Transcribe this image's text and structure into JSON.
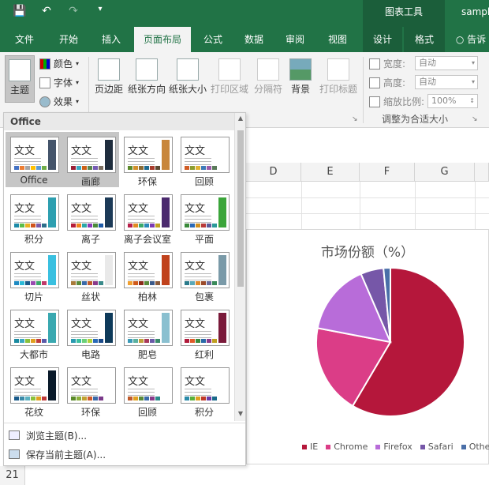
{
  "titlebar": {
    "context_group": "图表工具",
    "file_name": "sampl"
  },
  "tabs": [
    "文件",
    "开始",
    "插入",
    "页面布局",
    "公式",
    "数据",
    "审阅",
    "视图",
    "设计",
    "格式",
    "告诉"
  ],
  "ribbon": {
    "themes_label": "主题",
    "colors_label": "颜色",
    "fonts_label": "字体",
    "effects_label": "效果",
    "margins_label": "页边距",
    "orientation_label": "纸张方向",
    "size_label": "纸张大小",
    "print_area_label": "打印区域",
    "breaks_label": "分隔符",
    "background_label": "背景",
    "print_titles_label": "打印标题",
    "width_label": "宽度:",
    "width_value": "自动",
    "height_label": "高度:",
    "height_value": "自动",
    "scale_label": "缩放比例:",
    "scale_value": "100%",
    "fit_group_label": "调整为合适大小"
  },
  "columns": [
    "D",
    "E",
    "F",
    "G"
  ],
  "row_header": "21",
  "themes_panel": {
    "header": "Office",
    "sample_text": "文文",
    "themes": [
      {
        "name": "Office",
        "accent": "#44546a",
        "swatches": [
          "#4472c4",
          "#ed7d31",
          "#a5a5a5",
          "#ffc000",
          "#5b9bd5",
          "#70ad47"
        ]
      },
      {
        "name": "画廊",
        "accent": "#1f2d3d",
        "swatches": [
          "#9a1e35",
          "#38a8c2",
          "#cb5f15",
          "#57854d",
          "#765bb4",
          "#7c6f61"
        ]
      },
      {
        "name": "环保",
        "accent": "#c8863b",
        "swatches": [
          "#5b8a2a",
          "#d18f2b",
          "#8a6a33",
          "#1e6a8f",
          "#a83b2b",
          "#5b4a32"
        ]
      },
      {
        "name": "回顾",
        "accent": "#ffffff",
        "swatches": [
          "#d05c25",
          "#8a9c2e",
          "#e0b131",
          "#3d7ab8",
          "#9a5aa8",
          "#5a7a5a"
        ]
      },
      {
        "name": "积分",
        "accent": "#2e9fb0",
        "swatches": [
          "#1d8aa8",
          "#5bbd4a",
          "#e8b223",
          "#d0541c",
          "#7a5aa8",
          "#2a6e8a"
        ]
      },
      {
        "name": "离子",
        "accent": "#1c3a57",
        "swatches": [
          "#b51f3a",
          "#f1841b",
          "#2aa8a8",
          "#8a3ab8",
          "#4a8a3a",
          "#1d5aa8"
        ]
      },
      {
        "name": "离子会议室",
        "accent": "#4b2a6e",
        "swatches": [
          "#b81f4a",
          "#e08a22",
          "#3aa86a",
          "#2a8ab8",
          "#7a3ab0",
          "#c0a020"
        ]
      },
      {
        "name": "平面",
        "accent": "#3ba53a",
        "swatches": [
          "#3a8a3a",
          "#2a6ab8",
          "#d09020",
          "#b83a3a",
          "#5a5a9a",
          "#2a9a9a"
        ]
      },
      {
        "name": "切片",
        "accent": "#3ac0e0",
        "swatches": [
          "#1f8ac2",
          "#2abad8",
          "#1a5a8a",
          "#9a4ab0",
          "#3aa86a",
          "#c03a6a"
        ]
      },
      {
        "name": "丝状",
        "accent": "#e9e9e9",
        "swatches": [
          "#a87a3a",
          "#5a8a3a",
          "#3a6aa8",
          "#c05a2a",
          "#8a3a8a",
          "#3a8a8a"
        ]
      },
      {
        "name": "柏林",
        "accent": "#c0421c",
        "swatches": [
          "#f0a030",
          "#d05a1a",
          "#8a2a1a",
          "#5a8a3a",
          "#3a5a8a",
          "#8a5a3a"
        ]
      },
      {
        "name": "包裹",
        "accent": "#7a9aa8",
        "swatches": [
          "#2a7a8a",
          "#5aa8b8",
          "#e08a2a",
          "#9a4a2a",
          "#6a6a9a",
          "#3a8a5a"
        ]
      },
      {
        "name": "大都市",
        "accent": "#3aa8b0",
        "swatches": [
          "#1a8aa0",
          "#3aa8c0",
          "#8ac03a",
          "#e0a020",
          "#c03a3a",
          "#5a5aa8"
        ]
      },
      {
        "name": "电路",
        "accent": "#0e3a5a",
        "swatches": [
          "#2a9ab0",
          "#3ac0a0",
          "#6ad07a",
          "#b0d03a",
          "#2a6ab8",
          "#1a4a8a"
        ]
      },
      {
        "name": "肥皂",
        "accent": "#8ac0d0",
        "swatches": [
          "#3a9ab8",
          "#5ab0a0",
          "#c0a03a",
          "#a83a5a",
          "#6a5aa8",
          "#3a8a6a"
        ]
      },
      {
        "name": "红利",
        "accent": "#7a1a3a",
        "swatches": [
          "#b01a3a",
          "#e05a2a",
          "#3a8a3a",
          "#2a6aa8",
          "#8a3a8a",
          "#c0a020"
        ]
      },
      {
        "name": "花纹",
        "accent": "#0a1a2a",
        "swatches": [
          "#1a5a8a",
          "#3a8aa8",
          "#5ab0c0",
          "#8ac03a",
          "#e0a020",
          "#c03a3a"
        ]
      },
      {
        "name": "环保",
        "accent": "#ffffff",
        "swatches": [
          "#5a8a2a",
          "#8ab03a",
          "#c0a030",
          "#d05a2a",
          "#3a6aa8",
          "#7a3a8a"
        ]
      },
      {
        "name": "回顾",
        "accent": "#ffffff",
        "swatches": [
          "#c05a2a",
          "#e0a020",
          "#5a8a3a",
          "#3a6aa8",
          "#8a3a8a",
          "#2a8a8a"
        ]
      },
      {
        "name": "积分",
        "accent": "#ffffff",
        "swatches": [
          "#2a8aa8",
          "#5ab03a",
          "#e0a020",
          "#c03a2a",
          "#6a3aa8",
          "#1a6a8a"
        ]
      }
    ],
    "browse_label": "浏览主题(B)...",
    "save_label": "保存当前主题(A)..."
  },
  "chart_data": {
    "type": "pie",
    "title": "市场份额（%）",
    "categories": [
      "IE",
      "Chrome",
      "Firefox",
      "Safari",
      "Other"
    ],
    "values": [
      58.5,
      19.5,
      15.5,
      5.0,
      1.5
    ],
    "colors": [
      "#b5173b",
      "#db3d87",
      "#b86cd9",
      "#7657a8",
      "#4a6fa8"
    ],
    "legend_position": "bottom"
  },
  "colors": {
    "excel_green": "#217346",
    "context_green": "#1b5e3a"
  }
}
